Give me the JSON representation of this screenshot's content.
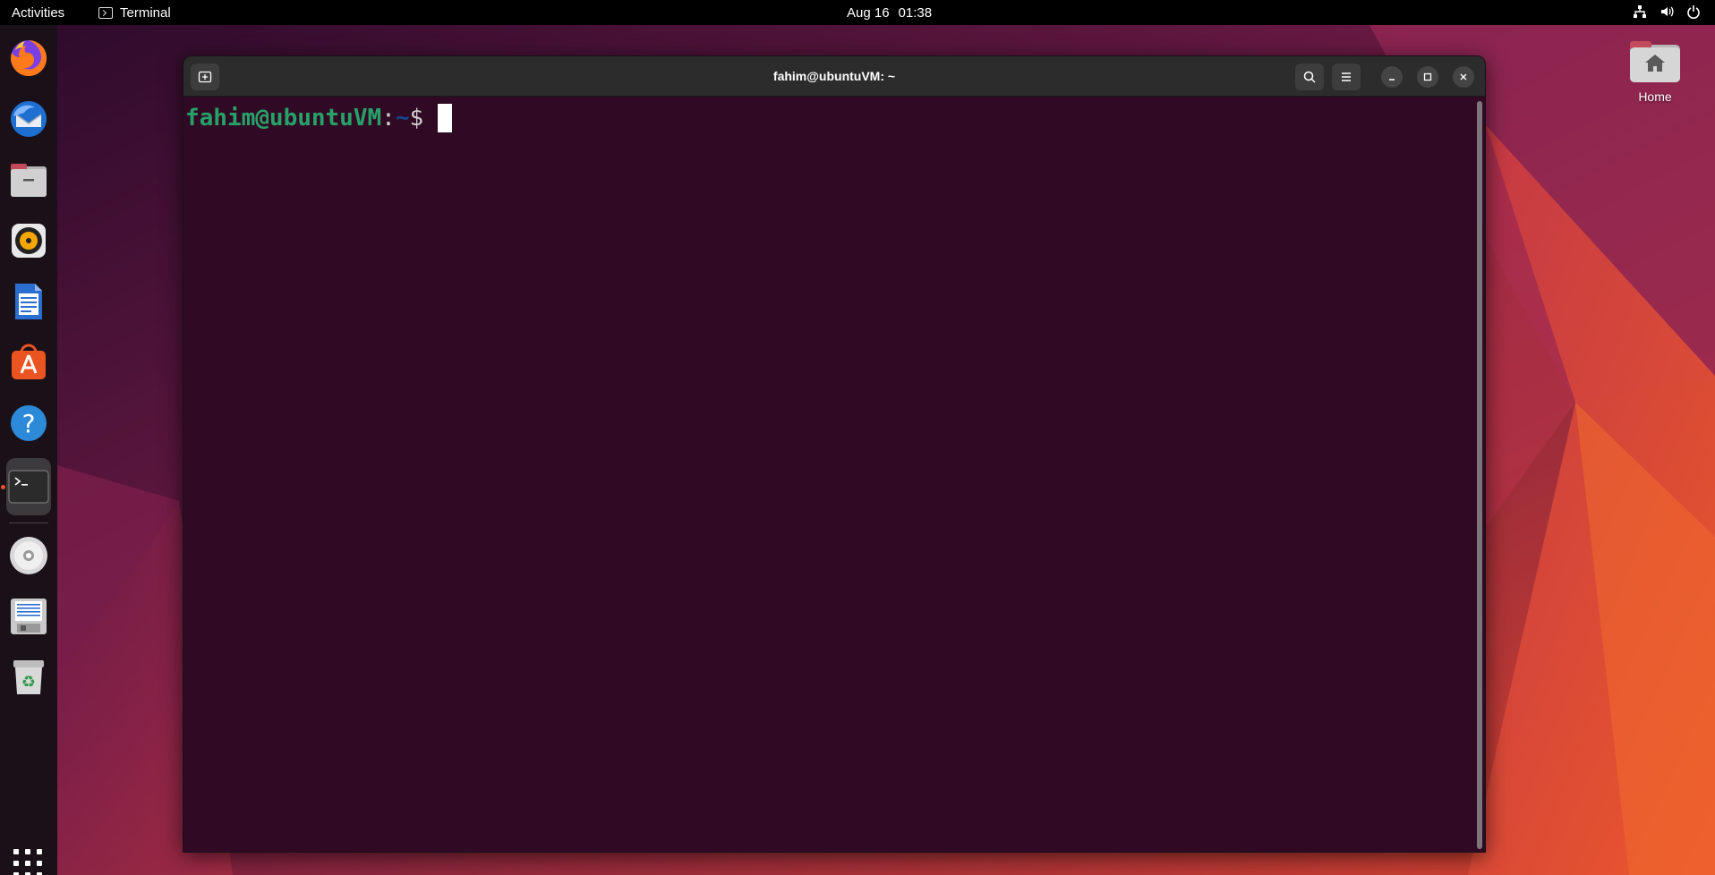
{
  "topbar": {
    "activities_label": "Activities",
    "app_name": "Terminal",
    "date": "Aug 16",
    "time": "01:38",
    "tray_icons": [
      "network-icon",
      "volume-icon",
      "power-icon"
    ]
  },
  "dock": {
    "items": [
      {
        "name": "firefox",
        "icon": "firefox-icon"
      },
      {
        "name": "thunderbird",
        "icon": "thunderbird-icon"
      },
      {
        "name": "files",
        "icon": "files-icon"
      },
      {
        "name": "rhythmbox",
        "icon": "rhythmbox-icon"
      },
      {
        "name": "libreoffice-writer",
        "icon": "writer-icon"
      },
      {
        "name": "ubuntu-software",
        "icon": "software-icon"
      },
      {
        "name": "help",
        "icon": "help-icon"
      },
      {
        "name": "terminal",
        "icon": "terminal-icon",
        "active": true
      },
      {
        "name": "disc",
        "icon": "disc-icon"
      },
      {
        "name": "save",
        "icon": "floppy-icon"
      },
      {
        "name": "trash",
        "icon": "trash-icon"
      }
    ],
    "app_grid_icon": "app-grid-icon"
  },
  "desktop": {
    "home_label": "Home"
  },
  "window": {
    "title": "fahim@ubuntuVM: ~",
    "prompt": {
      "user_host": "fahim@ubuntuVM",
      "colon": ":",
      "path": "~",
      "symbol": "$"
    }
  },
  "colors": {
    "terminal_bg": "#300a24",
    "prompt_user": "#26a269",
    "prompt_path": "#12488b",
    "accent": "#e95420"
  }
}
